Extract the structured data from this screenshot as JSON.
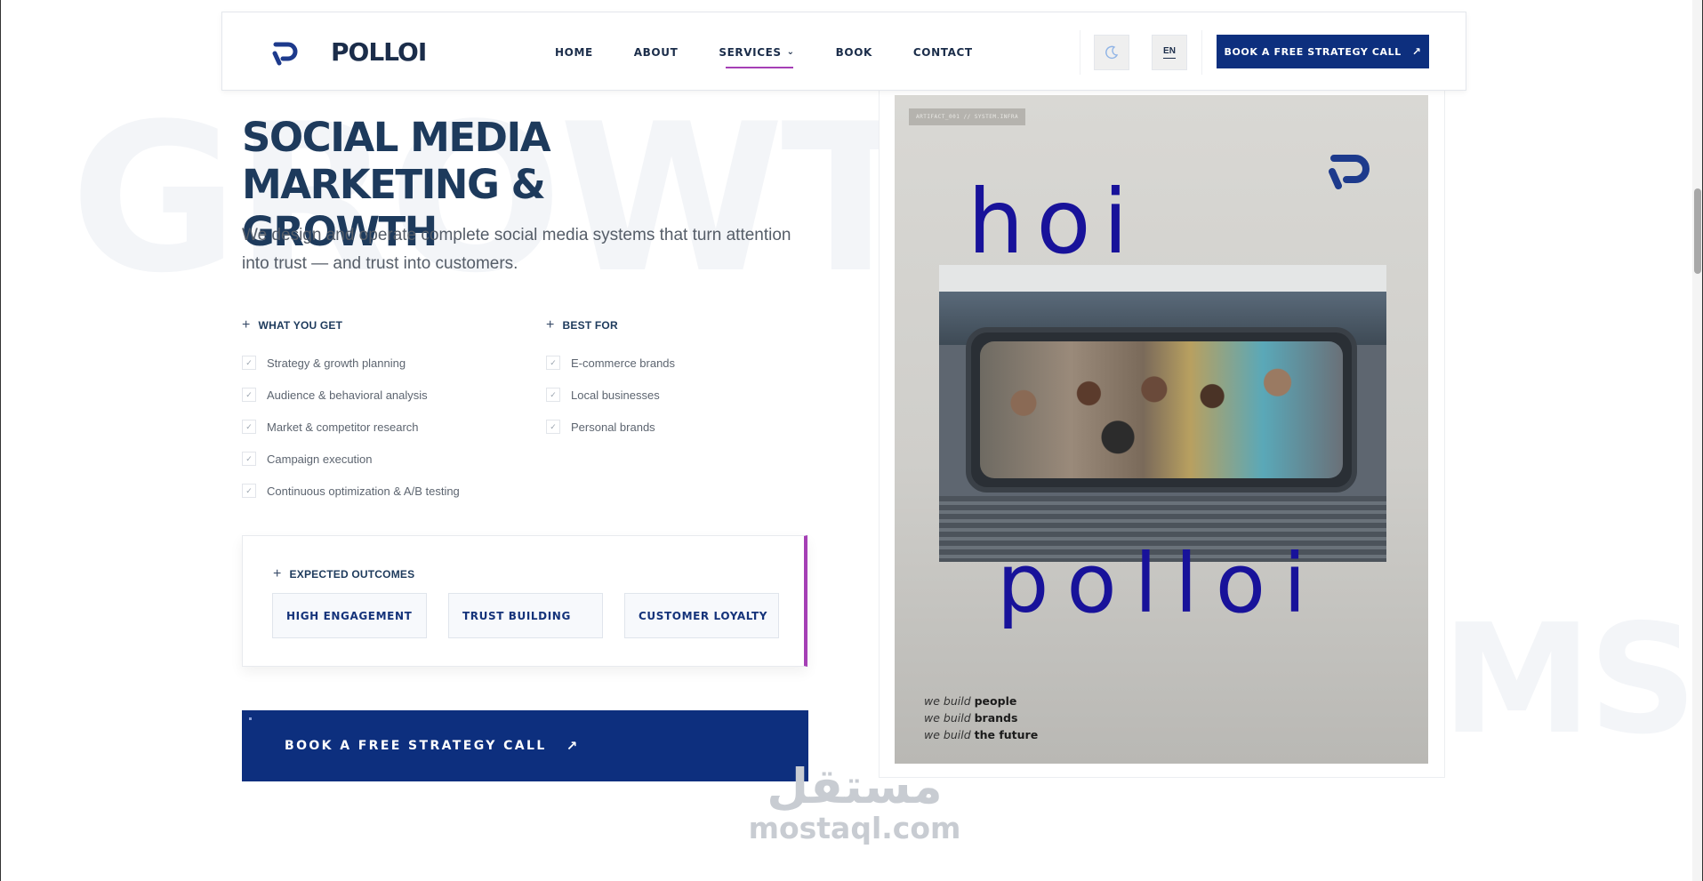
{
  "brand": {
    "name": "POLLOI",
    "accent": "#a53fb5",
    "primary": "#0d2f7e",
    "ink": "#1d3a5c"
  },
  "nav": {
    "items": [
      {
        "label": "HOME"
      },
      {
        "label": "ABOUT"
      },
      {
        "label": "SERVICES",
        "has_dropdown": true,
        "active": true
      },
      {
        "label": "BOOK"
      },
      {
        "label": "CONTACT"
      }
    ],
    "theme_toggle_icon": "moon-icon",
    "language": "EN",
    "cta_label": "BOOK A FREE STRATEGY CALL",
    "cta_icon": "arrow-up-right-icon"
  },
  "hero": {
    "bg_word_1": "GROWTH",
    "bg_word_2": "MS",
    "title_line1": "SOCIAL MEDIA MARKETING &",
    "title_line2": "GROWTH",
    "lead_line1": "We design and operate complete social media systems that turn attention",
    "lead_line2": "into trust — and trust into customers."
  },
  "what_you_get": {
    "heading": "WHAT YOU GET",
    "items": [
      "Strategy & growth planning",
      "Audience & behavioral analysis",
      "Market & competitor research",
      "Campaign execution",
      "Continuous optimization & A/B testing"
    ]
  },
  "best_for": {
    "heading": "BEST FOR",
    "items": [
      "E-commerce brands",
      "Local businesses",
      "Personal brands"
    ]
  },
  "outcomes": {
    "heading": "EXPECTED OUTCOMES",
    "chips": [
      "HIGH ENGAGEMENT",
      "TRUST BUILDING",
      "CUSTOMER LOYALTY"
    ]
  },
  "main_cta": {
    "label": "BOOK A FREE STRATEGY CALL",
    "icon": "arrow-up-right-icon"
  },
  "poster": {
    "tag": "ARTIFACT_001 // SYSTEM.INFRA",
    "word_top": "hoi",
    "word_bottom": "polloi",
    "tagline": [
      {
        "prefix": "we build",
        "word": "people"
      },
      {
        "prefix": "we build",
        "word": "brands"
      },
      {
        "prefix": "we build",
        "word": "the future"
      }
    ]
  },
  "watermark": {
    "arabic": "مستقل",
    "latin": "mostaql.com"
  }
}
